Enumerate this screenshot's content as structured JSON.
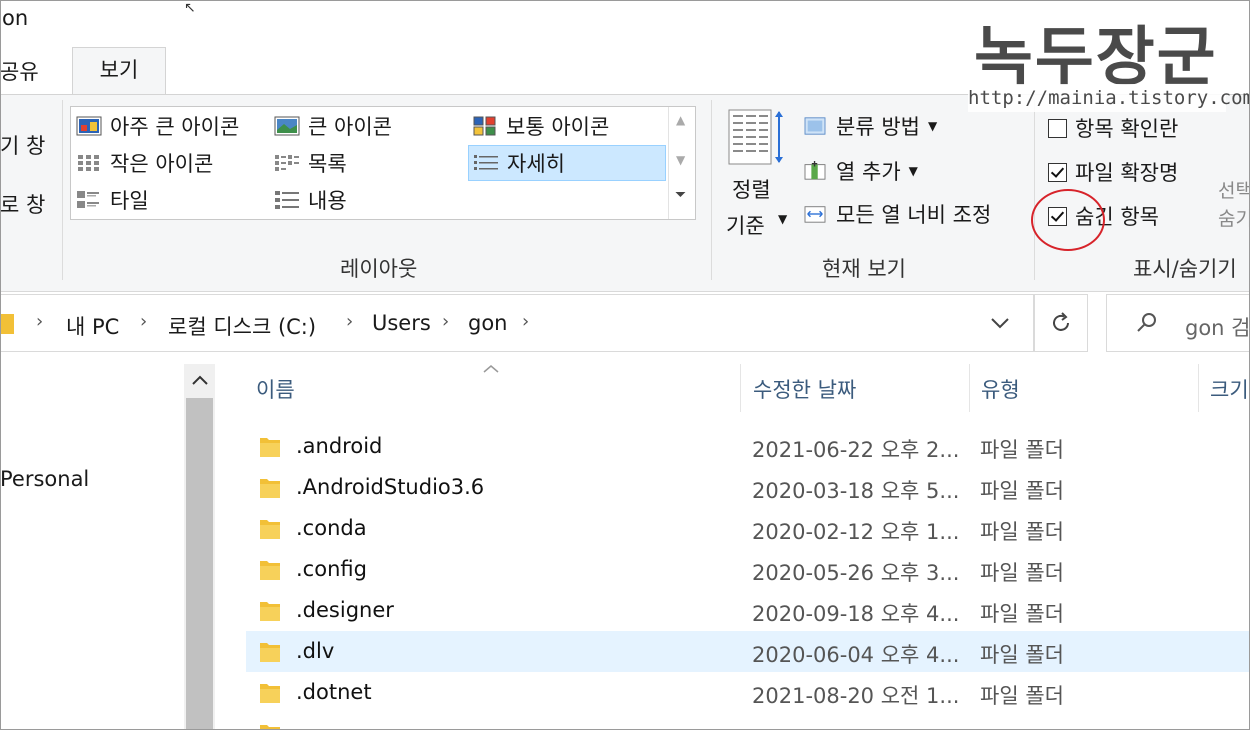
{
  "window": {
    "title": "on"
  },
  "tabs": {
    "share": "공유",
    "view": "보기"
  },
  "nav_pane_cut": {
    "item1": "기 창",
    "item2": "로 창"
  },
  "layout": {
    "items": [
      "아주 큰 아이콘",
      "큰 아이콘",
      "보통 아이콘",
      "작은 아이콘",
      "목록",
      "자세히",
      "타일",
      "내용"
    ],
    "selected": "자세히",
    "group_label": "레이아웃"
  },
  "current_view": {
    "sort_line1": "정렬",
    "sort_line2": "기준",
    "group_by": "분류 방법",
    "add_column": "열 추가",
    "fit_columns": "모든 열 너비 조정",
    "group_label": "현재 보기"
  },
  "show_hide": {
    "item_checkboxes": {
      "label": "항목 확인란",
      "checked": false
    },
    "file_extensions": {
      "label": "파일 확장명",
      "checked": true
    },
    "hidden_items": {
      "label": "숨긴 항목",
      "checked": true
    },
    "cut_line1": "선택",
    "cut_line2": "숨기",
    "group_label": "표시/숨기기"
  },
  "address": {
    "crumbs": [
      "내 PC",
      "로컬 디스크 (C:)",
      "Users",
      "gon"
    ]
  },
  "search": {
    "placeholder": "gon 검"
  },
  "nav": {
    "personal": "Personal"
  },
  "columns": {
    "name": "이름",
    "date": "수정한 날짜",
    "type": "유형",
    "size": "크기"
  },
  "files": [
    {
      "name": ".android",
      "date": "2021-06-22 오후 2...",
      "type": "파일 폴더"
    },
    {
      "name": ".AndroidStudio3.6",
      "date": "2020-03-18 오후 5...",
      "type": "파일 폴더"
    },
    {
      "name": ".conda",
      "date": "2020-02-12 오후 1...",
      "type": "파일 폴더"
    },
    {
      "name": ".config",
      "date": "2020-05-26 오후 3...",
      "type": "파일 폴더"
    },
    {
      "name": ".designer",
      "date": "2020-09-18 오후 4...",
      "type": "파일 폴더"
    },
    {
      "name": ".dlv",
      "date": "2020-06-04 오후 4...",
      "type": "파일 폴더"
    },
    {
      "name": ".dotnet",
      "date": "2021-08-20 오전 1...",
      "type": "파일 폴더"
    }
  ],
  "watermark": {
    "title": "녹두장군",
    "url": "http://mainia.tistory.com"
  },
  "colors": {
    "selection": "#cce8ff",
    "row_selected": "#e5f3ff",
    "annotation_circle": "#d7232a",
    "folder": "#f2c037"
  }
}
